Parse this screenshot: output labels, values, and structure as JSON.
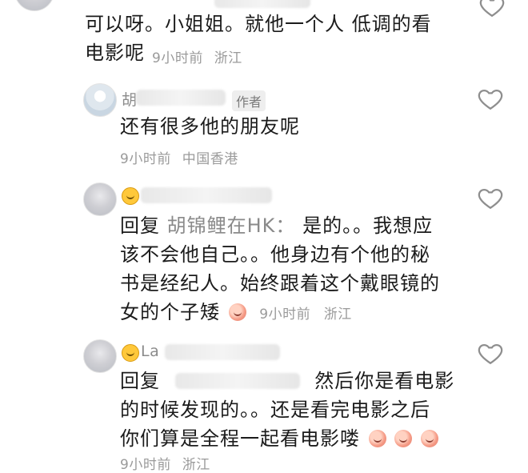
{
  "comments": [
    {
      "text_line1": "可以呀。小姐姐。就他一个人 低调的看",
      "text_line2": "电影呢",
      "time": "9小时前",
      "location": "浙江"
    },
    {
      "name_visible": "胡",
      "author_tag": "作者",
      "text": "还有很多他的朋友呢",
      "time": "9小时前",
      "location": "中国香港"
    },
    {
      "reply_label": "回复",
      "reply_to": "胡锦鲤在HK：",
      "text_line1_rest": "是的。。我想应",
      "text_line2": "该不会他自己。。他身边有个他的秘",
      "text_line3": "书是经纪人。始终跟着这个戴眼镜的",
      "text_line4": "女的个子矮",
      "time": "9小时前",
      "location": "浙江"
    },
    {
      "name_visible": "La",
      "reply_label": "回复",
      "text_line1_rest": "然后你是看电影",
      "text_line2": "的时候发现的。。还是看完电影之后",
      "text_line3": "你们算是全程一起看电影喽",
      "time": "9小时前",
      "location": "浙江"
    }
  ],
  "colors": {
    "text": "#1b1b1b",
    "meta": "#9a9a9a",
    "heart_stroke": "#8e8e8e"
  },
  "icons": [
    "heart-icon",
    "peach-emoji",
    "smile-emoji"
  ]
}
